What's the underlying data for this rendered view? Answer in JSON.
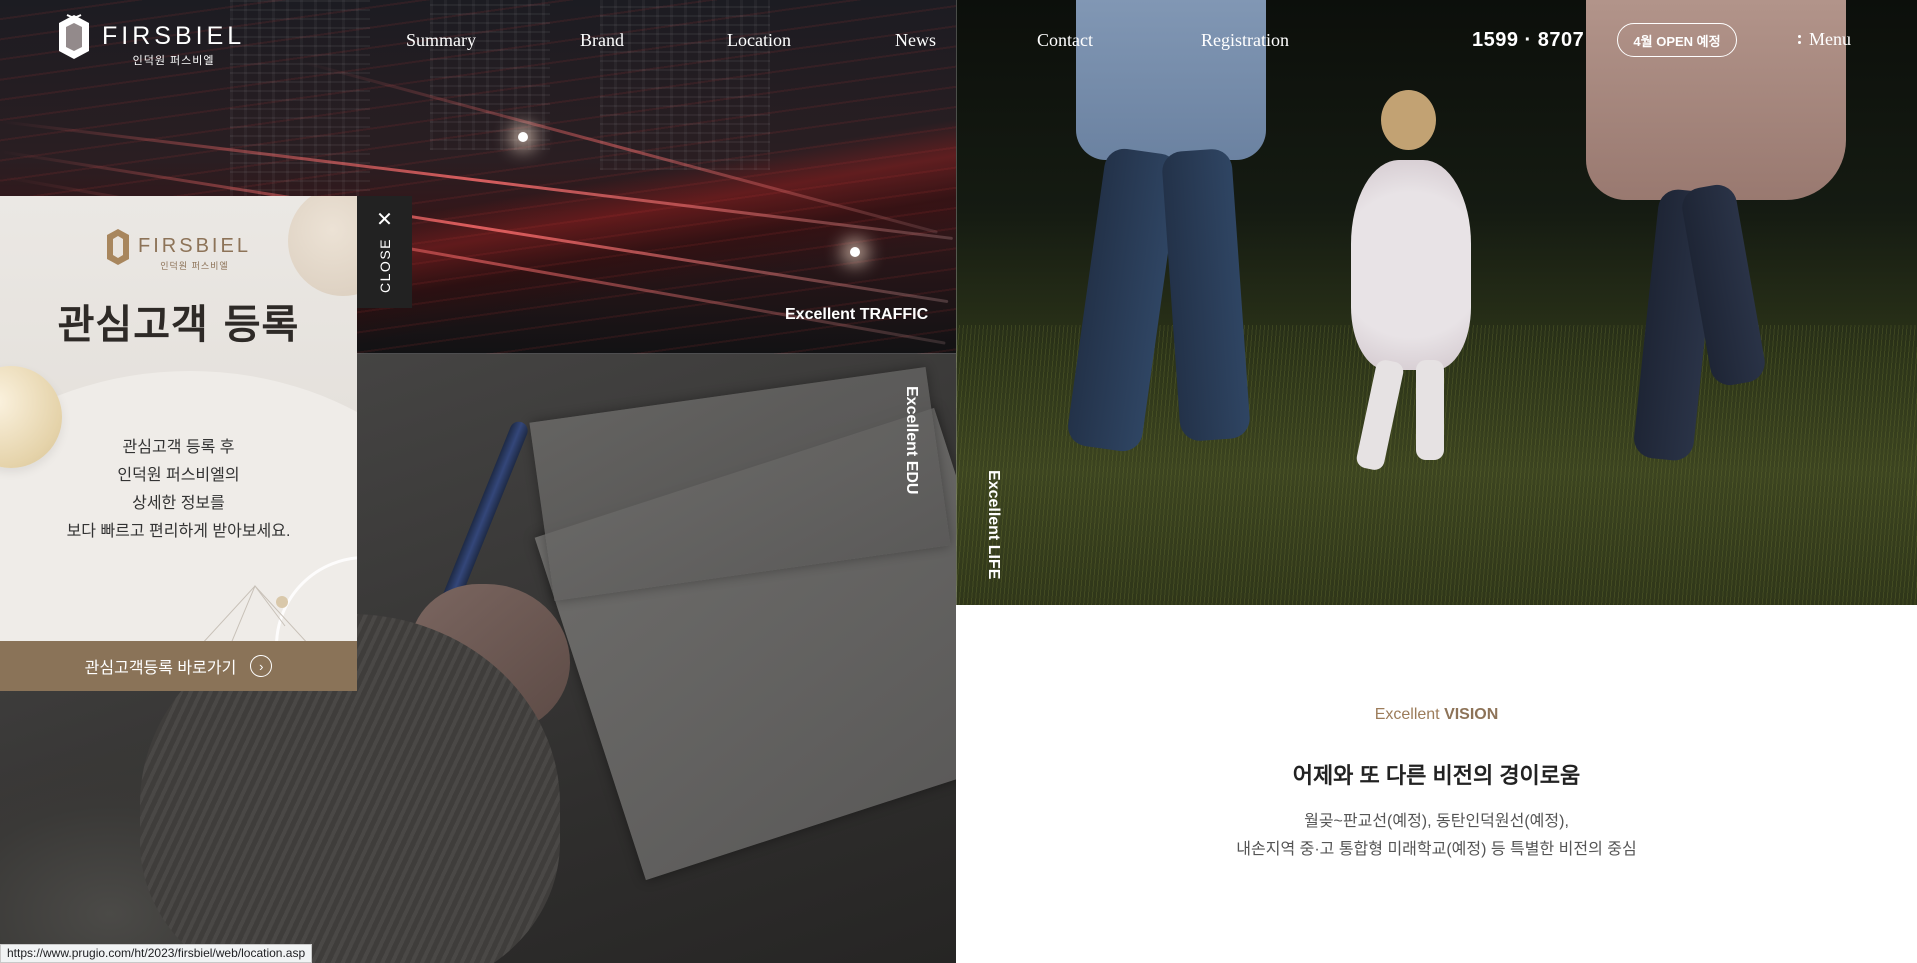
{
  "header": {
    "logo_word": "FIRSBIEL",
    "logo_sub": "인덕원 퍼스비엘",
    "nav": [
      {
        "label": "Summary"
      },
      {
        "label": "Brand"
      },
      {
        "label": "Location"
      },
      {
        "label": "News"
      },
      {
        "label": "Contact"
      },
      {
        "label": "Registration"
      }
    ],
    "phone": "1599 · 8707",
    "open_badge": "4월 OPEN 예정",
    "menu_label": "Menu"
  },
  "sections": {
    "traffic_label": "Excellent TRAFFIC",
    "edu_label": "Excellent EDU",
    "life_label": "Excellent LIFE"
  },
  "popup": {
    "logo_word": "FIRSBIEL",
    "logo_sub": "인덕원 퍼스비엘",
    "title": "관심고객 등록",
    "desc_lines": [
      "관심고객 등록 후",
      "인덕원 퍼스비엘의",
      "상세한 정보를",
      "보다 빠르고 편리하게 받아보세요."
    ],
    "cta_label": "관심고객등록 바로가기",
    "close_label": "CLOSE"
  },
  "vision": {
    "subtitle_prefix": "Excellent",
    "subtitle_strong": "VISION",
    "heading": "어제와 또 다른 비전의 경이로움",
    "body_lines": [
      "월곶~판교선(예정), 동탄인덕원선(예정),",
      "내손지역 중·고 통합형 미래학교(예정) 등 특별한 비전의 중심"
    ]
  },
  "status_url": "https://www.prugio.com/ht/2023/firsbiel/web/location.asp",
  "colors": {
    "accent_brown": "#8a7358",
    "gold_text": "#9c7c5a",
    "popup_bg": "#e4e0db",
    "close_bg": "#222222"
  }
}
